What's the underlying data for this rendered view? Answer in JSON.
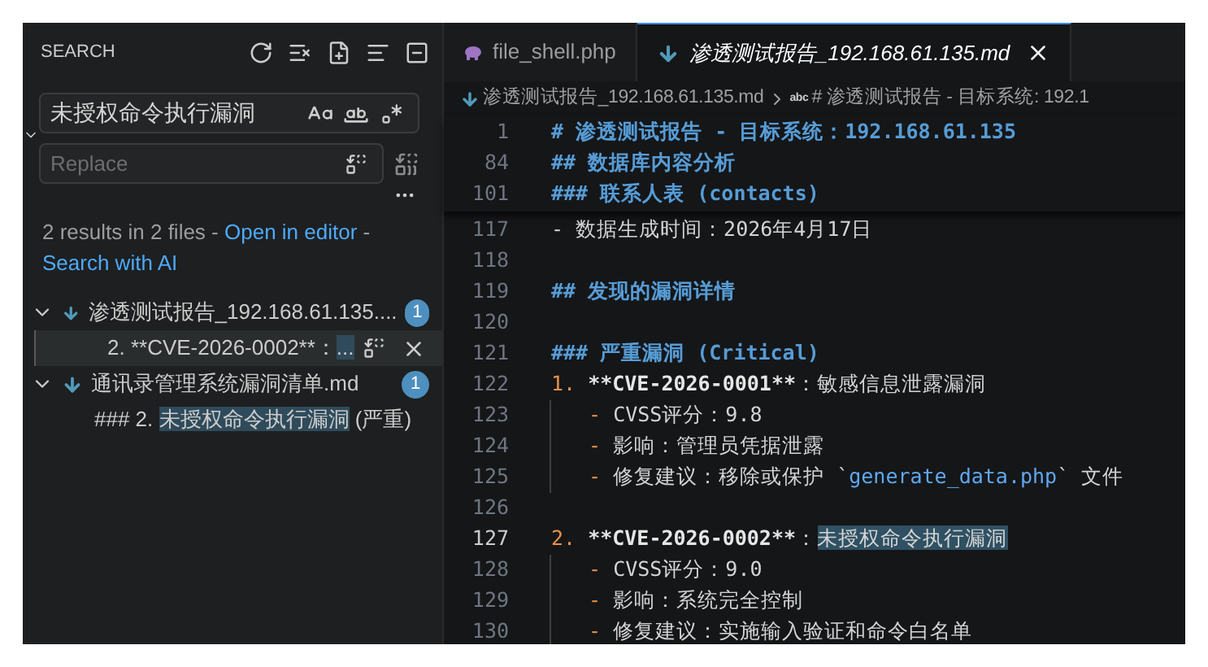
{
  "sidebar": {
    "title": "SEARCH",
    "search": {
      "value": "未授权命令执行漏洞",
      "match_case": false,
      "whole_word": false,
      "regex": false
    },
    "replace": {
      "placeholder": "Replace",
      "preserve_case": false,
      "expanded": true
    },
    "message": {
      "text": "2 results in 2 files - ",
      "links": [
        "Open in editor",
        "Search with AI"
      ],
      "separator": " - "
    },
    "results": [
      {
        "file": "渗透测试报告_192.168.61.135....",
        "count": "1",
        "expanded": true,
        "matches": [
          {
            "before": "2. **CVE-2026-0002**：",
            "match": "...",
            "selected": true
          }
        ]
      },
      {
        "file": "通讯录管理系统漏洞清单.md",
        "count": "1",
        "expanded": true,
        "matches": [
          {
            "before": "### 2. ",
            "match": "未授权命令执行漏洞",
            "after": " (严重)",
            "selected": false
          }
        ]
      }
    ]
  },
  "tabs": [
    {
      "label": "file_shell.php",
      "kind": "php",
      "selected": false,
      "preview": false
    },
    {
      "label": "渗透测试报告_192.168.61.135.md",
      "kind": "markdown",
      "selected": true,
      "preview": true
    }
  ],
  "breadcrumb": {
    "file": "渗透测试报告_192.168.61.135.md",
    "symbol_icon": "abc",
    "symbol": "# 渗透测试报告 - 目标系统: 192.1"
  },
  "sticky_lines": [
    {
      "number": "1",
      "segments": [
        {
          "kind": "heading",
          "text": "# 渗透测试报告 - 目标系统：192.168.61.135"
        }
      ]
    },
    {
      "number": "84",
      "segments": [
        {
          "kind": "heading",
          "text": "## 数据库内容分析"
        }
      ]
    },
    {
      "number": "101",
      "segments": [
        {
          "kind": "heading",
          "text": "### 联系人表 (contacts)"
        }
      ]
    }
  ],
  "lines": [
    {
      "number": "117",
      "current": false,
      "indented": false,
      "segments": [
        {
          "kind": "text",
          "text": "- 数据生成时间：2026年4月17日"
        }
      ]
    },
    {
      "number": "118",
      "current": false,
      "indented": false
    },
    {
      "number": "119",
      "current": false,
      "indented": false,
      "segments": [
        {
          "kind": "heading",
          "text": "## 发现的漏洞详情"
        }
      ]
    },
    {
      "number": "120",
      "current": false,
      "indented": false
    },
    {
      "number": "121",
      "current": false,
      "indented": false,
      "segments": [
        {
          "kind": "heading",
          "text": "### 严重漏洞 (Critical)"
        }
      ]
    },
    {
      "number": "122",
      "current": false,
      "indented": false,
      "segments": [
        {
          "kind": "marker",
          "text": "1. "
        },
        {
          "kind": "bold",
          "text": "**CVE-2026-0001**"
        },
        {
          "kind": "text",
          "text": "：敏感信息泄露漏洞"
        }
      ]
    },
    {
      "number": "123",
      "current": false,
      "indented": true,
      "segments": [
        {
          "kind": "marker",
          "text": "- "
        },
        {
          "kind": "text",
          "text": "CVSS评分：9.8"
        }
      ]
    },
    {
      "number": "124",
      "current": false,
      "indented": true,
      "segments": [
        {
          "kind": "marker",
          "text": "- "
        },
        {
          "kind": "text",
          "text": "影响：管理员凭据泄露"
        }
      ]
    },
    {
      "number": "125",
      "current": false,
      "indented": true,
      "segments": [
        {
          "kind": "marker",
          "text": "- "
        },
        {
          "kind": "text",
          "text": "修复建议：移除或保护 `"
        },
        {
          "kind": "code",
          "text": "generate_data.php"
        },
        {
          "kind": "text",
          "text": "` 文件"
        }
      ]
    },
    {
      "number": "126",
      "current": false,
      "indented": false
    },
    {
      "number": "127",
      "current": true,
      "indented": false,
      "segments": [
        {
          "kind": "marker",
          "text": "2. "
        },
        {
          "kind": "bold",
          "text": "**CVE-2026-0002**"
        },
        {
          "kind": "text",
          "text": "："
        },
        {
          "kind": "match",
          "text": "未授权命令执行漏洞"
        }
      ]
    },
    {
      "number": "128",
      "current": false,
      "indented": true,
      "segments": [
        {
          "kind": "marker",
          "text": "- "
        },
        {
          "kind": "text",
          "text": "CVSS评分：9.0"
        }
      ]
    },
    {
      "number": "129",
      "current": false,
      "indented": true,
      "segments": [
        {
          "kind": "marker",
          "text": "- "
        },
        {
          "kind": "text",
          "text": "影响：系统完全控制"
        }
      ]
    },
    {
      "number": "130",
      "current": false,
      "indented": true,
      "segments": [
        {
          "kind": "marker",
          "text": "- "
        },
        {
          "kind": "text",
          "text": "修复建议：实施输入验证和命令白名单"
        }
      ]
    }
  ]
}
